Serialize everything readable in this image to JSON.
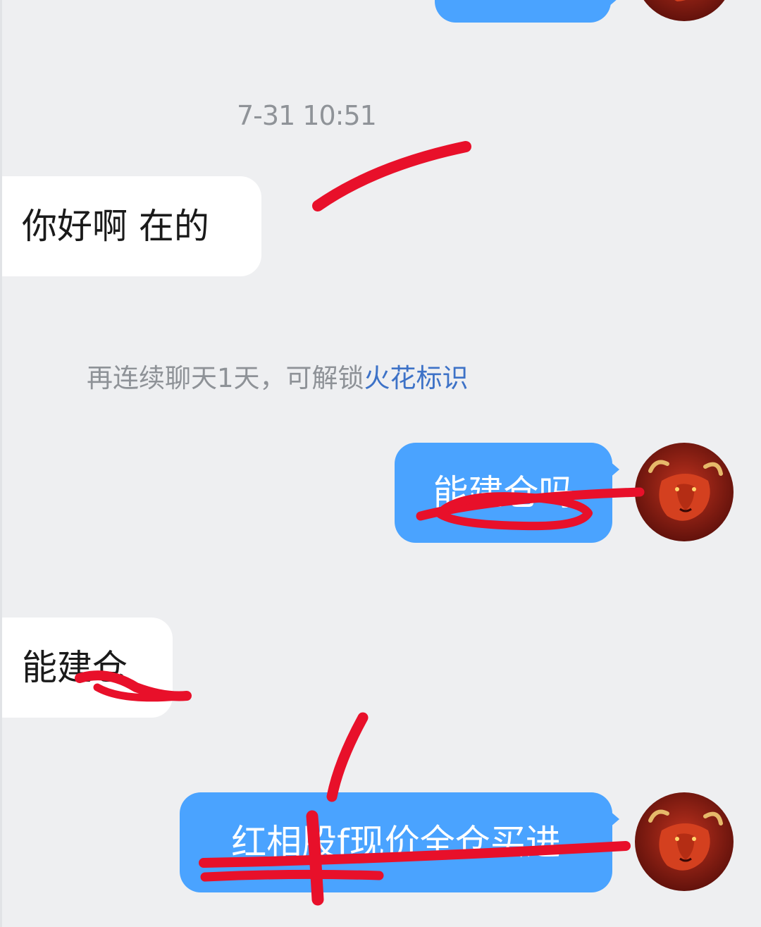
{
  "chat": {
    "timestamp": "7-31 10:51",
    "messages": [
      {
        "direction": "in",
        "text": "你好啊 在的"
      },
      {
        "direction": "out",
        "text": "能建仓吗"
      },
      {
        "direction": "in",
        "text": "能建仓"
      },
      {
        "direction": "out",
        "text": "红相股f现价全仓买进"
      }
    ],
    "system_tip": {
      "prefix": "再连续聊天1天，可解锁",
      "link": "火花标识"
    },
    "avatar_icon": "bull-icon"
  },
  "colors": {
    "background": "#eeeff1",
    "outgoing_bubble": "#4aa3ff",
    "incoming_bubble": "#ffffff",
    "scribble": "#e8102a",
    "link": "#3d72c7"
  }
}
